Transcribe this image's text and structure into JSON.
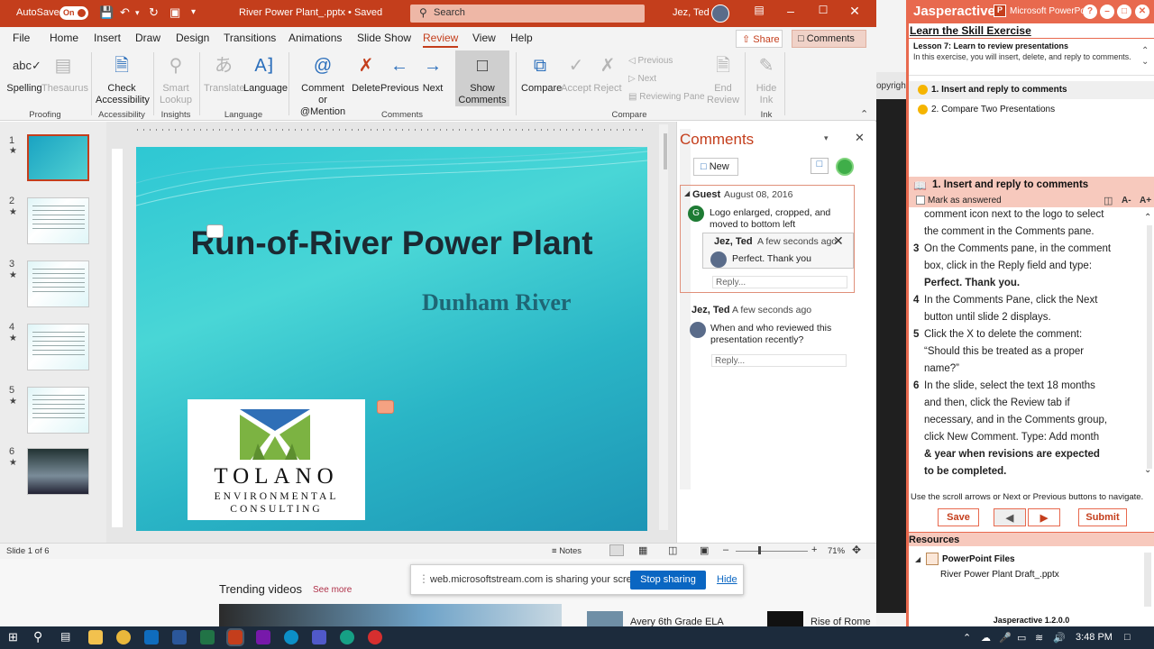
{
  "titlebar": {
    "autosave_label": "AutoSave",
    "autosave_state": "On",
    "doc_title": "River Power Plant_.pptx  •  Saved",
    "search_placeholder": "Search",
    "user_name": "Jez, Ted"
  },
  "ribbon_tabs": [
    "File",
    "Home",
    "Insert",
    "Draw",
    "Design",
    "Transitions",
    "Animations",
    "Slide Show",
    "Review",
    "View",
    "Help"
  ],
  "active_tab": "Review",
  "header_buttons": {
    "share": "Share",
    "comments": "Comments"
  },
  "ribbon": {
    "spelling": "Spelling",
    "thesaurus": "Thesaurus",
    "check_accessibility_1": "Check",
    "check_accessibility_2": "Accessibility",
    "smart_lookup_1": "Smart",
    "smart_lookup_2": "Lookup",
    "translate": "Translate",
    "language": "Language",
    "comment_mention_1": "Comment or",
    "comment_mention_2": "@Mention",
    "delete": "Delete",
    "previous": "Previous",
    "next": "Next",
    "show_comments_1": "Show",
    "show_comments_2": "Comments",
    "compare": "Compare",
    "accept": "Accept",
    "reject": "Reject",
    "prev_small": "Previous",
    "next_small": "Next",
    "reviewing_pane": "Reviewing Pane",
    "end_review_1": "End",
    "end_review_2": "Review",
    "hide_ink_1": "Hide",
    "hide_ink_2": "Ink",
    "groups": {
      "proofing": "Proofing",
      "accessibility": "Accessibility",
      "insights": "Insights",
      "language": "Language",
      "comments": "Comments",
      "compare": "Compare",
      "ink": "Ink"
    }
  },
  "slides": [
    {
      "num": "1",
      "star": "★"
    },
    {
      "num": "2",
      "star": "★"
    },
    {
      "num": "3",
      "star": "★"
    },
    {
      "num": "4",
      "star": "★"
    },
    {
      "num": "5",
      "star": "★"
    },
    {
      "num": "6",
      "star": "★"
    }
  ],
  "slide": {
    "title": "Run-of-River Power Plant",
    "subtitle": "Dunham River",
    "logo_word": "TOLANO",
    "logo_sub1": "ENVIRONMENTAL",
    "logo_sub2": "CONSULTING"
  },
  "comments_pane": {
    "title": "Comments",
    "new_label": "New",
    "thread1": {
      "author": "Guest",
      "avatar_letter": "G",
      "date": "August 08, 2016",
      "body_1": "Logo enlarged, cropped, and",
      "body_2": "moved to bottom left",
      "reply_author": "Jez, Ted",
      "reply_date": "A few seconds ago",
      "reply_body": "Perfect. Thank you",
      "reply_placeholder": "Reply..."
    },
    "thread2": {
      "author": "Jez, Ted",
      "date": "A few seconds ago",
      "body_1": "When and who reviewed this",
      "body_2": "presentation recently?",
      "reply_placeholder": "Reply..."
    }
  },
  "statusbar": {
    "slide_info": "Slide 1 of 6",
    "notes": "Notes",
    "zoom": "71%"
  },
  "browser": {
    "trending": "Trending videos",
    "see_more": "See more",
    "share_msg": "web.microsoftstream.com is sharing your screen.",
    "stop_sharing": "Stop sharing",
    "hide": "Hide",
    "video1": "Avery 6th Grade ELA",
    "video2": "Rise of Rome"
  },
  "backdrop_text": "opyright",
  "jasper": {
    "logo": "Jasperactive",
    "app": "Microsoft PowerPoint",
    "heading": "Learn the Skill Exercise",
    "lesson_title": "Lesson 7: Learn to review presentations",
    "lesson_desc": "In this exercise, you will insert, delete, and reply to comments.",
    "tasks": [
      "1. Insert and reply to comments",
      "2. Compare Two Presentations"
    ],
    "task_header": "1. Insert and reply to comments",
    "mark_answered": "Mark as answered",
    "font_small": "A-",
    "font_large": "A+",
    "steps": [
      {
        "n": "",
        "text": "comment icon next to the logo to select"
      },
      {
        "n": "",
        "text": "the comment in the Comments pane."
      },
      {
        "n": "3",
        "text": "On the Comments pane, in the comment"
      },
      {
        "n": "",
        "text": "box, click in the Reply field and type:"
      },
      {
        "n": "",
        "text": "Perfect. Thank you."
      },
      {
        "n": "4",
        "text": "In the Comments Pane, click the Next"
      },
      {
        "n": "",
        "text": "button until slide 2 displays."
      },
      {
        "n": "5",
        "text": "Click the X to delete the comment:"
      },
      {
        "n": "",
        "text": "“Should this be treated as a proper"
      },
      {
        "n": "",
        "text": "name?”"
      },
      {
        "n": "6",
        "text": "In the slide, select the text 18 months"
      },
      {
        "n": "",
        "text": "and then, click the Review tab if"
      },
      {
        "n": "",
        "text": "necessary, and in the Comments group,"
      },
      {
        "n": "",
        "text": "click New Comment. Type: Add month"
      },
      {
        "n": "",
        "text": "& year when revisions are expected"
      },
      {
        "n": "",
        "text": "to be completed."
      }
    ],
    "nav_hint": "Use the scroll arrows or Next or Previous buttons to navigate.",
    "save": "Save",
    "submit": "Submit",
    "resources": "Resources",
    "res_folder": "PowerPoint Files",
    "res_file": "River Power Plant Draft_.pptx",
    "version": "Jasperactive 1.2.0.0"
  },
  "taskbar": {
    "time": "3:48 PM"
  },
  "colors": {
    "ppt_accent": "#c43e1c",
    "jasper_accent": "#e8694e",
    "link_blue": "#0a66c2"
  }
}
